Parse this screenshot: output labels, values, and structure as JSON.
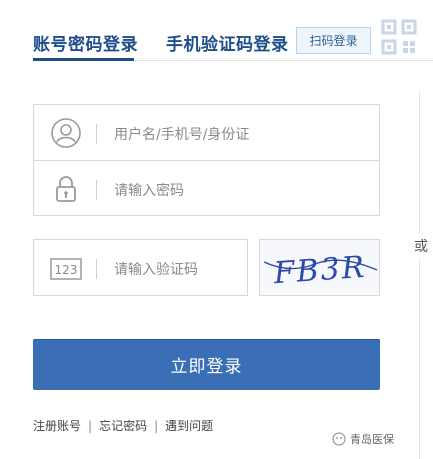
{
  "tabs": [
    {
      "label": "账号密码登录",
      "active": true
    },
    {
      "label": "手机验证码登录",
      "active": false
    }
  ],
  "qr": {
    "chip_label": "扫码登录",
    "icon": "qr-code-icon"
  },
  "form": {
    "username_placeholder": "用户名/手机号/身份证",
    "password_placeholder": "请输入密码",
    "captcha_placeholder": "请输入验证码",
    "captcha_text": "FB3R",
    "captcha_icon_text": "123"
  },
  "or_label": "或",
  "login_button": "立即登录",
  "footer": {
    "register": "注册账号",
    "forgot": "忘记密码",
    "problem": "遇到问题",
    "separator": "|"
  },
  "watermark": "青岛医保",
  "colors": {
    "primary": "#3a6fb5",
    "tab_text": "#1f4e8a"
  }
}
